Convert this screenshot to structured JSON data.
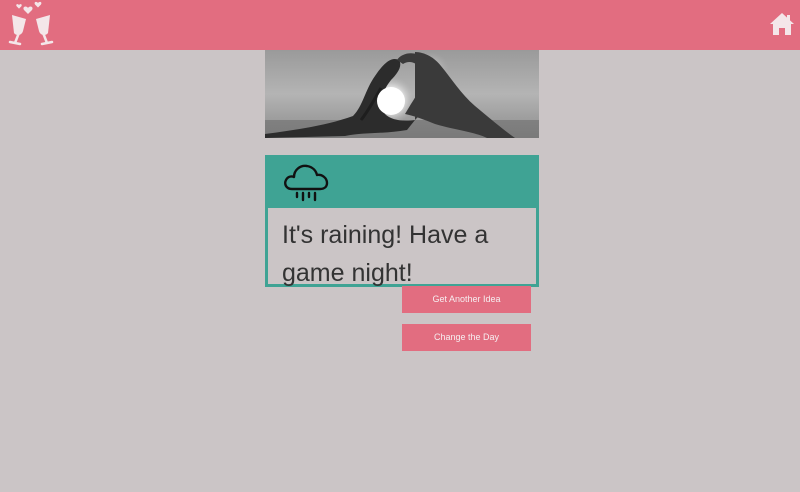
{
  "header": {
    "logo_icon": "wine-glasses-toast-icon",
    "home_icon": "home-icon",
    "bar_color": "#e26d80"
  },
  "hero": {
    "image": "hands-heart-sun-photo"
  },
  "weather_card": {
    "icon": "rain-cloud-icon",
    "message": "It's raining! Have a game night!",
    "accent_color": "#3fa394"
  },
  "actions": {
    "another_idea_label": "Get Another Idea",
    "change_day_label": "Change the Day"
  }
}
